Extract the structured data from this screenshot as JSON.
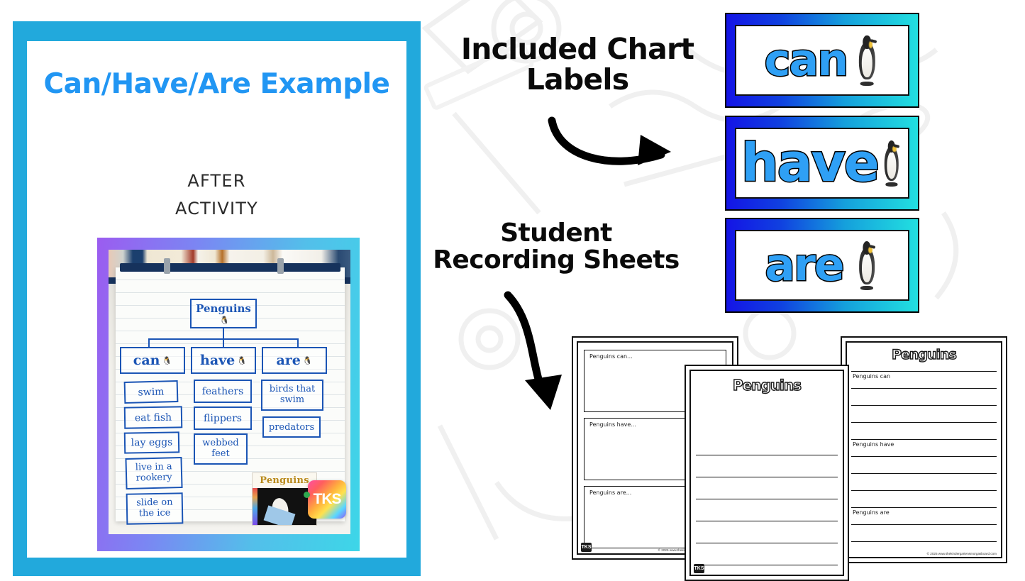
{
  "preview": {
    "title_line1": "Can/Have/Are",
    "title_line2": "Example",
    "subtitle_line1": "AFTER",
    "subtitle_line2": "ACTIVITY",
    "border_color": "#22a9dc",
    "title_color": "#2196f3",
    "photo_frame_gradient_from": "#9b5cf0",
    "photo_frame_gradient_to": "#3dd6e8",
    "anchor_chart": {
      "topic": "Penguins",
      "columns": [
        {
          "heading": "can",
          "items": [
            "swim",
            "eat fish",
            "lay eggs",
            "live in a rookery",
            "slide on the ice"
          ]
        },
        {
          "heading": "have",
          "items": [
            "feathers",
            "flippers",
            "webbed feet"
          ]
        },
        {
          "heading": "are",
          "items": [
            "birds that swim",
            "predators"
          ]
        }
      ],
      "book_title": "Penguins",
      "logo_text": "TKS"
    }
  },
  "callouts": {
    "chart_labels": {
      "line1": "Included Chart",
      "line2": "Labels"
    },
    "recording_sheets": {
      "line1": "Student",
      "line2": "Recording Sheets"
    }
  },
  "chart_labels": {
    "gradient_from": "#1414e6",
    "gradient_to": "#22e0e0",
    "word_color": "#2fa0f5",
    "cards": [
      {
        "word": "can",
        "icon": "penguin-photo"
      },
      {
        "word": "have",
        "icon": "penguin-photo"
      },
      {
        "word": "are",
        "icon": "penguin-photo"
      }
    ]
  },
  "recording_sheets": {
    "copyright": "© 2025 www.thekindergartensmorgasboard.com",
    "logo_text": "TKS",
    "sheets": [
      {
        "id": "three-box-sheet",
        "layout": "three-boxes",
        "title": "",
        "prompts": [
          "Penguins can...",
          "Penguins have...",
          "Penguins are..."
        ]
      },
      {
        "id": "draw-and-write-sheet",
        "layout": "draw-and-write",
        "title": "Penguins",
        "prompts": [],
        "line_count": 6
      },
      {
        "id": "lined-sheet",
        "layout": "lined-prompts",
        "title": "Penguins",
        "prompts": [
          "Penguins can",
          "Penguins have",
          "Penguins are"
        ],
        "line_count": 11
      }
    ]
  }
}
